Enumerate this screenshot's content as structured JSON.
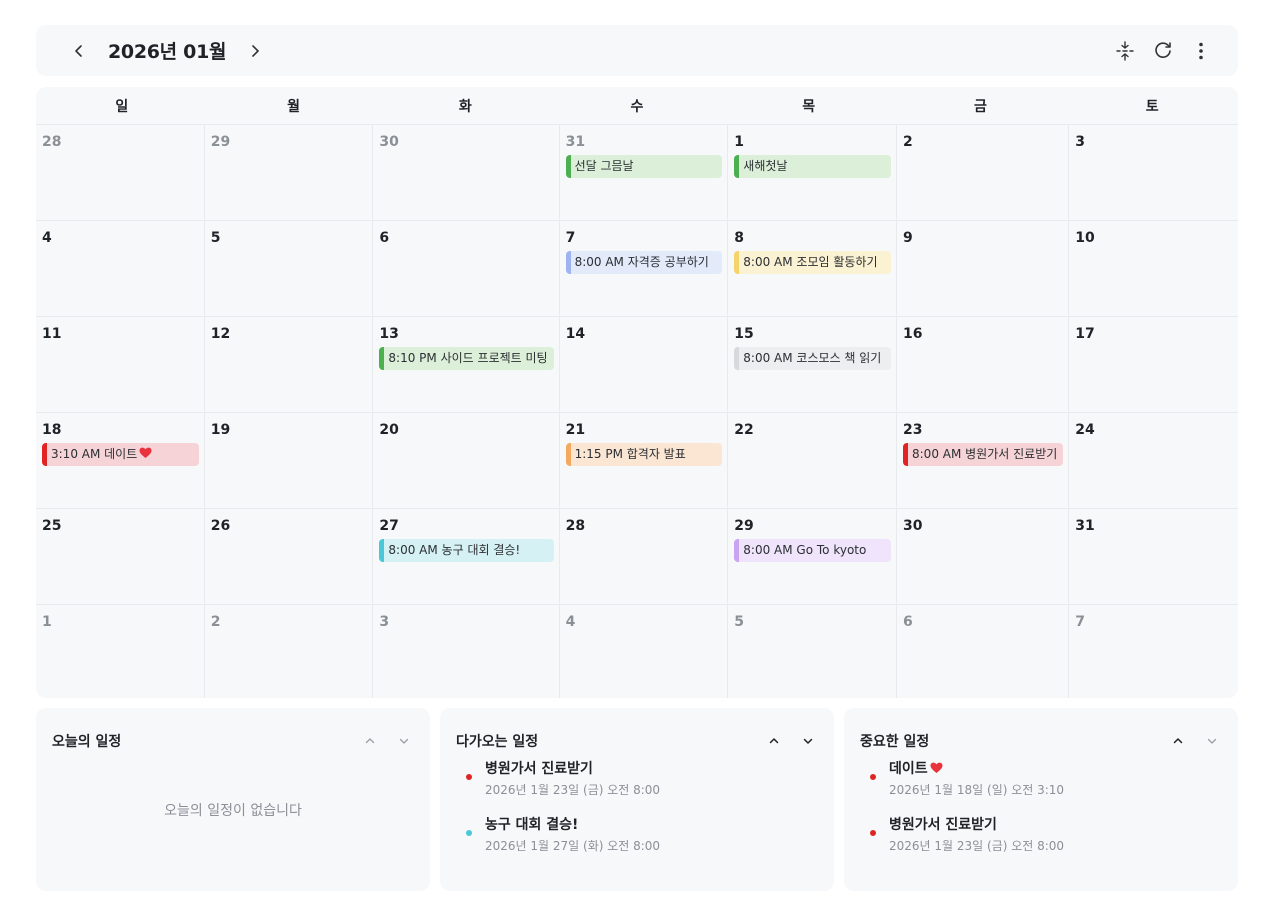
{
  "header": {
    "title": "2026년 01월",
    "icons": {
      "prev": "chevron-left-icon",
      "next": "chevron-right-icon",
      "collapse": "collapse-icon",
      "refresh": "refresh-icon",
      "more": "more-vertical-icon"
    }
  },
  "weekdays": [
    "일",
    "월",
    "화",
    "수",
    "목",
    "금",
    "토"
  ],
  "weeks": [
    [
      {
        "day": "28",
        "muted": true,
        "events": []
      },
      {
        "day": "29",
        "muted": true,
        "events": []
      },
      {
        "day": "30",
        "muted": true,
        "events": []
      },
      {
        "day": "31",
        "muted": true,
        "events": [
          {
            "label": "선달 그믐날",
            "color": "#4caf50",
            "bg": "#dcefd9"
          }
        ]
      },
      {
        "day": "1",
        "events": [
          {
            "label": "새해첫날",
            "color": "#4caf50",
            "bg": "#dcefd9"
          }
        ]
      },
      {
        "day": "2",
        "events": []
      },
      {
        "day": "3",
        "events": []
      }
    ],
    [
      {
        "day": "4",
        "events": []
      },
      {
        "day": "5",
        "events": []
      },
      {
        "day": "6",
        "events": []
      },
      {
        "day": "7",
        "events": [
          {
            "label": "8:00 AM 자격증 공부하기",
            "color": "#9db4f0",
            "bg": "#e3ebfb"
          }
        ]
      },
      {
        "day": "8",
        "events": [
          {
            "label": "8:00 AM 조모임 활동하기",
            "color": "#f5d36b",
            "bg": "#fbf1d3"
          }
        ]
      },
      {
        "day": "9",
        "events": []
      },
      {
        "day": "10",
        "events": []
      }
    ],
    [
      {
        "day": "11",
        "events": []
      },
      {
        "day": "12",
        "events": []
      },
      {
        "day": "13",
        "events": [
          {
            "label": "8:10 PM 사이드 프로젝트 미팅",
            "color": "#4caf50",
            "bg": "#dcefd9"
          }
        ]
      },
      {
        "day": "14",
        "events": []
      },
      {
        "day": "15",
        "events": [
          {
            "label": "8:00 AM 코스모스 책 읽기",
            "color": "#d7d9dc",
            "bg": "#eceef0"
          }
        ]
      },
      {
        "day": "16",
        "events": []
      },
      {
        "day": "17",
        "events": []
      }
    ],
    [
      {
        "day": "18",
        "events": [
          {
            "label": "3:10 AM 데이트",
            "heart": "heart-icon",
            "color": "#e02424",
            "bg": "#f5d3d6"
          }
        ]
      },
      {
        "day": "19",
        "events": []
      },
      {
        "day": "20",
        "events": []
      },
      {
        "day": "21",
        "events": [
          {
            "label": "1:15 PM 합격자 발표",
            "color": "#f4a95e",
            "bg": "#fbe6d4"
          }
        ]
      },
      {
        "day": "22",
        "events": []
      },
      {
        "day": "23",
        "events": [
          {
            "label": "8:00 AM 병원가서 진료받기",
            "color": "#e02424",
            "bg": "#f5d3d6"
          }
        ]
      },
      {
        "day": "24",
        "events": []
      }
    ],
    [
      {
        "day": "25",
        "events": []
      },
      {
        "day": "26",
        "events": []
      },
      {
        "day": "27",
        "events": [
          {
            "label": "8:00 AM 농구 대회 결승!",
            "color": "#4ac8d8",
            "bg": "#d6f1f4"
          }
        ]
      },
      {
        "day": "28",
        "events": []
      },
      {
        "day": "29",
        "events": [
          {
            "label": "8:00 AM Go To kyoto",
            "color": "#c9a4f2",
            "bg": "#efe4fb"
          }
        ]
      },
      {
        "day": "30",
        "events": []
      },
      {
        "day": "31",
        "events": []
      }
    ],
    [
      {
        "day": "1",
        "muted": true,
        "events": []
      },
      {
        "day": "2",
        "muted": true,
        "events": []
      },
      {
        "day": "3",
        "muted": true,
        "events": []
      },
      {
        "day": "4",
        "muted": true,
        "events": []
      },
      {
        "day": "5",
        "muted": true,
        "events": []
      },
      {
        "day": "6",
        "muted": true,
        "events": []
      },
      {
        "day": "7",
        "muted": true,
        "events": []
      }
    ]
  ],
  "panels": {
    "today": {
      "title": "오늘의 일정",
      "empty": "오늘의 일정이 없습니다"
    },
    "upcoming": {
      "title": "다가오는 일정",
      "items": [
        {
          "title": "병원가서 진료받기",
          "date": "2026년 1월 23일 (금) 오전 8:00",
          "color": "#e02424"
        },
        {
          "title": "농구 대회 결승!",
          "date": "2026년 1월 27일 (화) 오전 8:00",
          "color": "#4ac8d8"
        }
      ]
    },
    "important": {
      "title": "중요한 일정",
      "items": [
        {
          "title": "데이트",
          "heart": "heart-icon",
          "date": "2026년 1월 18일 (일) 오전 3:10",
          "color": "#e02424"
        },
        {
          "title": "병원가서 진료받기",
          "date": "2026년 1월 23일 (금) 오전 8:00",
          "color": "#e02424"
        }
      ]
    }
  }
}
